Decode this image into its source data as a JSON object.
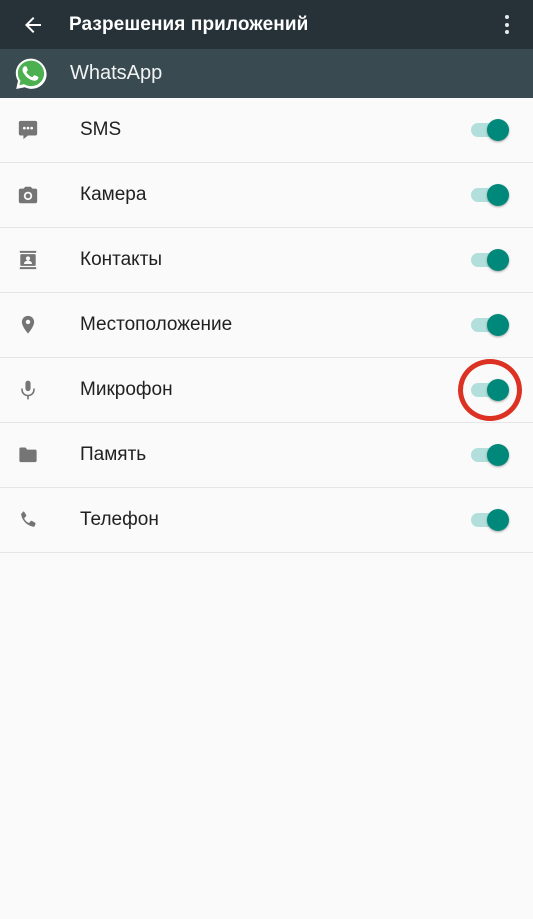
{
  "appbar": {
    "title": "Разрешения приложений",
    "back_icon": "arrow-left-icon",
    "overflow_icon": "more-vertical-icon",
    "background_color": "#263238",
    "title_color": "#FFFFFF"
  },
  "app_header": {
    "name": "WhatsApp",
    "icon": "whatsapp-icon",
    "icon_color": "#4CAF50",
    "background_color": "#3A4A51"
  },
  "permissions": [
    {
      "label": "SMS",
      "icon": "sms-icon",
      "enabled": true,
      "highlighted": false
    },
    {
      "label": "Камера",
      "icon": "camera-icon",
      "enabled": true,
      "highlighted": false
    },
    {
      "label": "Контакты",
      "icon": "contacts-icon",
      "enabled": true,
      "highlighted": false
    },
    {
      "label": "Местоположение",
      "icon": "location-icon",
      "enabled": true,
      "highlighted": false
    },
    {
      "label": "Микрофон",
      "icon": "mic-icon",
      "enabled": true,
      "highlighted": true
    },
    {
      "label": "Память",
      "icon": "folder-icon",
      "enabled": true,
      "highlighted": false
    },
    {
      "label": "Телефон",
      "icon": "phone-icon",
      "enabled": true,
      "highlighted": false
    }
  ],
  "colors": {
    "switch_track_on": "#B2DFDB",
    "switch_thumb_on": "#00897B",
    "annotation_ring": "#DC3223",
    "list_background": "#FAFAFA",
    "icon_gray": "#757575",
    "label_text": "#212121",
    "divider": "#E4E6E6"
  }
}
